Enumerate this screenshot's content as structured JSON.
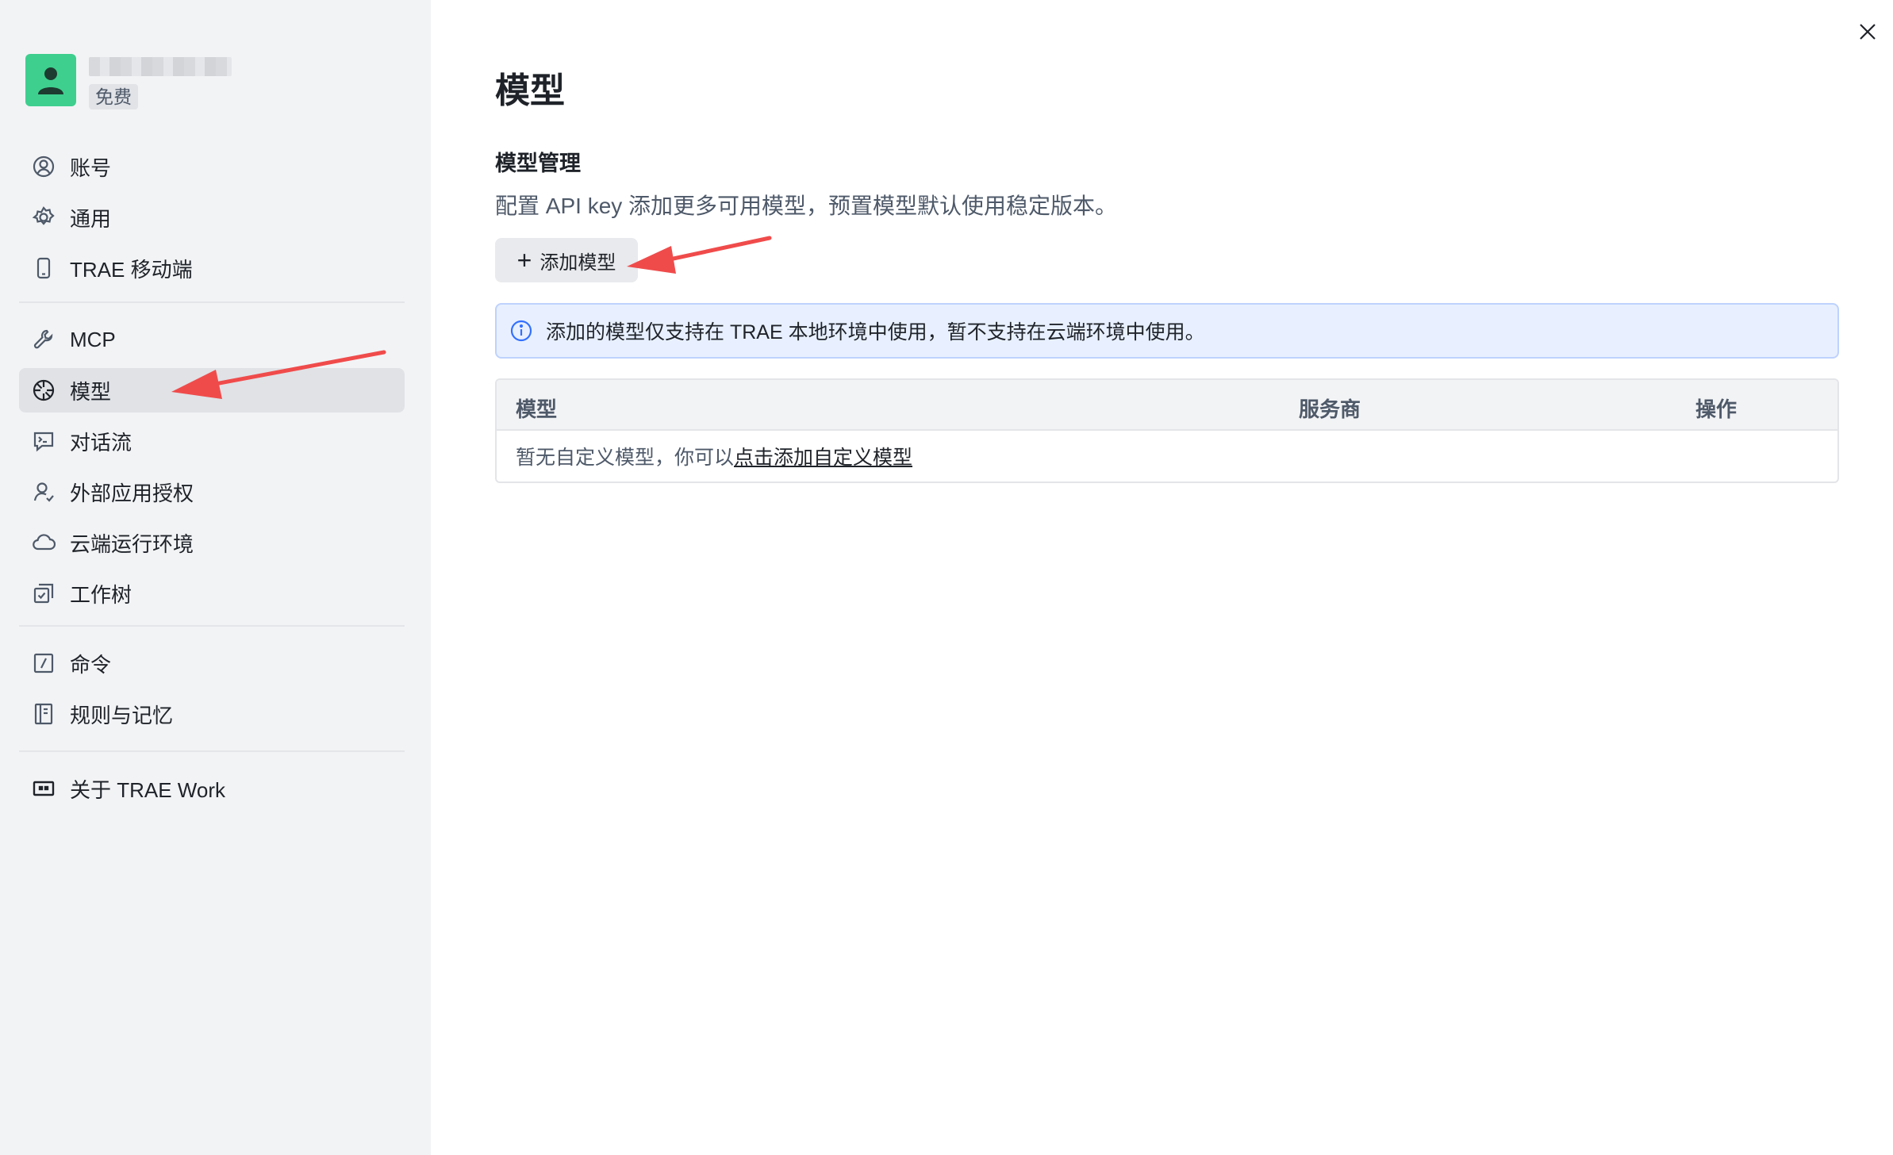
{
  "sidebar": {
    "profile": {
      "plan": "免费"
    },
    "items_group1": [
      {
        "label": "账号",
        "icon": "user-circle-icon"
      },
      {
        "label": "通用",
        "icon": "gear-icon"
      },
      {
        "label": "TRAE 移动端",
        "icon": "mobile-icon"
      }
    ],
    "items_group2": [
      {
        "label": "MCP",
        "icon": "wrench-icon"
      },
      {
        "label": "模型",
        "icon": "model-icon",
        "active": true
      },
      {
        "label": "对话流",
        "icon": "terminal-chat-icon"
      },
      {
        "label": "外部应用授权",
        "icon": "user-auth-icon"
      },
      {
        "label": "云端运行环境",
        "icon": "cloud-icon"
      },
      {
        "label": "工作树",
        "icon": "worktree-icon"
      }
    ],
    "items_group3": [
      {
        "label": "命令",
        "icon": "slash-command-icon"
      },
      {
        "label": "规则与记忆",
        "icon": "book-icon"
      }
    ],
    "items_group4": [
      {
        "label": "关于 TRAE Work",
        "icon": "about-icon"
      }
    ]
  },
  "main": {
    "title": "模型",
    "section_title": "模型管理",
    "section_desc": "配置 API key 添加更多可用模型，预置模型默认使用稳定版本。",
    "add_button": "添加模型",
    "notice": "添加的模型仅支持在 TRAE 本地环境中使用，暂不支持在云端环境中使用。",
    "table": {
      "columns": [
        "模型",
        "服务商",
        "操作"
      ],
      "empty_text": "暂无自定义模型，你可以",
      "empty_link": "点击添加自定义模型"
    }
  },
  "colors": {
    "accent_arrow": "#f04b4b",
    "avatar": "#3ecf8e",
    "notice_bg": "#e8f0ff",
    "notice_icon": "#3370ff"
  }
}
